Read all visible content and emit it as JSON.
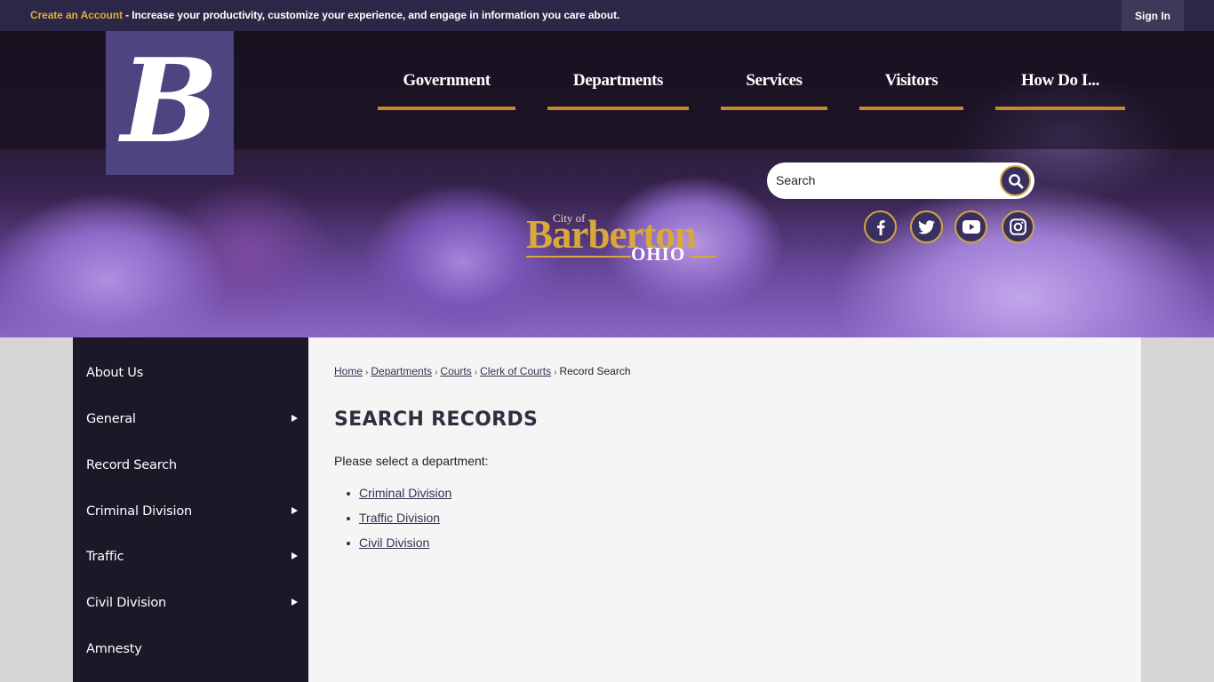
{
  "topbar": {
    "create_account_link": "Create an Account",
    "message": " - Increase your productivity, customize your experience, and engage in information you care about.",
    "sign_in_label": "Sign In"
  },
  "header": {
    "logo_letter": "B",
    "site_title": {
      "city_of": "City of",
      "name": "Barberton",
      "state": "OHIO"
    },
    "nav": [
      {
        "label": "Government"
      },
      {
        "label": "Departments"
      },
      {
        "label": "Services"
      },
      {
        "label": "Visitors"
      },
      {
        "label": "How Do I..."
      }
    ],
    "search": {
      "placeholder": "Search",
      "value": "",
      "button_icon": "search-icon"
    },
    "social": [
      {
        "name": "facebook",
        "icon": "facebook-icon"
      },
      {
        "name": "twitter",
        "icon": "twitter-icon"
      },
      {
        "name": "youtube",
        "icon": "youtube-icon"
      },
      {
        "name": "instagram",
        "icon": "instagram-icon"
      }
    ]
  },
  "sidebar": {
    "items": [
      {
        "label": "About Us",
        "has_submenu": false
      },
      {
        "label": "General",
        "has_submenu": true
      },
      {
        "label": "Record Search",
        "has_submenu": false
      },
      {
        "label": "Criminal Division",
        "has_submenu": true
      },
      {
        "label": "Traffic",
        "has_submenu": true
      },
      {
        "label": "Civil Division",
        "has_submenu": true
      },
      {
        "label": "Amnesty",
        "has_submenu": false
      }
    ]
  },
  "main": {
    "breadcrumb": [
      {
        "label": "Home",
        "link": true
      },
      {
        "label": "Departments",
        "link": true
      },
      {
        "label": "Courts",
        "link": true
      },
      {
        "label": "Clerk of Courts",
        "link": true
      },
      {
        "label": "Record Search",
        "link": false
      }
    ],
    "breadcrumb_separator": "›",
    "title": "SEARCH RECORDS",
    "intro": "Please select a department:",
    "departments": [
      {
        "label": "Criminal Division"
      },
      {
        "label": "Traffic Division"
      },
      {
        "label": "Civil Division"
      }
    ]
  },
  "colors": {
    "topbar_bg": "#2d2747",
    "accent_gold": "#e0ab3c",
    "nav_underline": "#c7862f",
    "logo_bg": "#4e4480",
    "sidebar_bg": "#1c1828",
    "content_bg": "#f5f5f5",
    "page_bg": "#d6d6d6"
  }
}
